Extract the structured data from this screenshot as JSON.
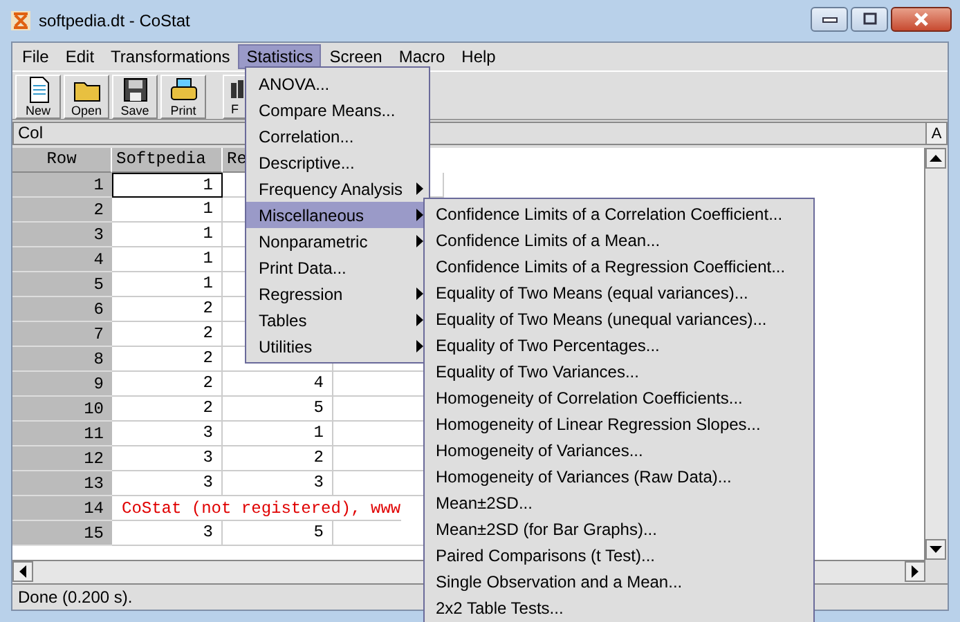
{
  "window": {
    "title": "softpedia.dt - CoStat"
  },
  "menu_bar": [
    {
      "label": "File",
      "selected": false
    },
    {
      "label": "Edit",
      "selected": false
    },
    {
      "label": "Transformations",
      "selected": false
    },
    {
      "label": "Statistics",
      "selected": true
    },
    {
      "label": "Screen",
      "selected": false
    },
    {
      "label": "Macro",
      "selected": false
    },
    {
      "label": "Help",
      "selected": false
    }
  ],
  "toolbar": [
    {
      "label": "New",
      "kind": "new"
    },
    {
      "label": "Open",
      "kind": "open"
    },
    {
      "label": "Save",
      "kind": "save"
    },
    {
      "label": "Print",
      "kind": "print"
    },
    {
      "label": "F",
      "kind": "find"
    }
  ],
  "column_field": {
    "value": "Col"
  },
  "column_field_button": "A",
  "table": {
    "columns": [
      "Row",
      "Softpedia",
      "Re"
    ],
    "rows": [
      {
        "cells": [
          "1",
          "1",
          ""
        ],
        "selected": true
      },
      {
        "cells": [
          "2",
          "1",
          ""
        ],
        "selected": false
      },
      {
        "cells": [
          "3",
          "1",
          ""
        ],
        "selected": false
      },
      {
        "cells": [
          "4",
          "1",
          ""
        ],
        "selected": false
      },
      {
        "cells": [
          "5",
          "1",
          ""
        ],
        "selected": false
      },
      {
        "cells": [
          "6",
          "2",
          ""
        ],
        "selected": false
      },
      {
        "cells": [
          "7",
          "2",
          ""
        ],
        "selected": false
      },
      {
        "cells": [
          "8",
          "2",
          ""
        ],
        "selected": false
      },
      {
        "cells": [
          "9",
          "2",
          "4"
        ],
        "selected": false
      },
      {
        "cells": [
          "10",
          "2",
          "5"
        ],
        "selected": false
      },
      {
        "cells": [
          "11",
          "3",
          "1"
        ],
        "selected": false
      },
      {
        "cells": [
          "12",
          "3",
          "2"
        ],
        "selected": false
      },
      {
        "cells": [
          "13",
          "3",
          "3"
        ],
        "selected": false
      },
      {
        "cells": [
          "14"
        ],
        "notice": "CoStat (not registered), www",
        "selected": false
      },
      {
        "cells": [
          "15",
          "3",
          "5"
        ],
        "selected": false
      }
    ]
  },
  "status_bar": "Done (0.200 s).",
  "statistics_menu": [
    {
      "label": "ANOVA...",
      "submenu": false,
      "selected": false
    },
    {
      "label": "Compare Means...",
      "submenu": false,
      "selected": false
    },
    {
      "label": "Correlation...",
      "submenu": false,
      "selected": false
    },
    {
      "label": "Descriptive...",
      "submenu": false,
      "selected": false
    },
    {
      "label": "Frequency Analysis",
      "submenu": true,
      "selected": false
    },
    {
      "label": "Miscellaneous",
      "submenu": true,
      "selected": true
    },
    {
      "label": "Nonparametric",
      "submenu": true,
      "selected": false
    },
    {
      "label": "Print Data...",
      "submenu": false,
      "selected": false
    },
    {
      "label": "Regression",
      "submenu": true,
      "selected": false
    },
    {
      "label": "Tables",
      "submenu": true,
      "selected": false
    },
    {
      "label": "Utilities",
      "submenu": true,
      "selected": false
    }
  ],
  "miscellaneous_menu": [
    "Confidence Limits of a Correlation Coefficient...",
    "Confidence Limits of a Mean...",
    "Confidence Limits of a Regression Coefficient...",
    "Equality of Two Means (equal variances)...",
    "Equality of Two Means (unequal variances)...",
    "Equality of Two Percentages...",
    "Equality of Two Variances...",
    "Homogeneity of Correlation Coefficients...",
    "Homogeneity of Linear Regression Slopes...",
    "Homogeneity of Variances...",
    "Homogeneity of Variances (Raw Data)...",
    "Mean±2SD...",
    "Mean±2SD (for Bar Graphs)...",
    "Paired Comparisons (t Test)...",
    "Single Observation and a Mean...",
    "2x2 Table Tests..."
  ]
}
